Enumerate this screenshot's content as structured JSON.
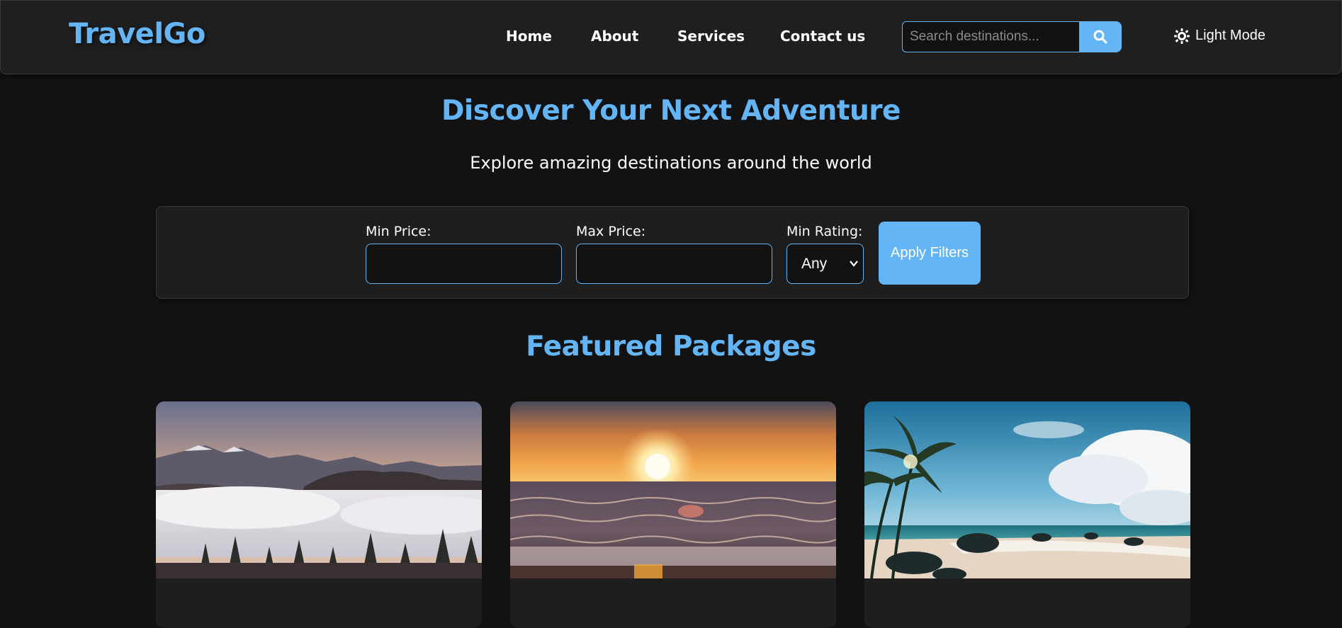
{
  "brand": {
    "name": "TravelGo"
  },
  "nav": {
    "links": [
      "Home",
      "About",
      "Services",
      "Contact us"
    ]
  },
  "search": {
    "placeholder": "Search destinations...",
    "icon": "search-icon"
  },
  "theme_toggle": {
    "label": "Light Mode",
    "icon": "sun-icon"
  },
  "hero": {
    "title": "Discover Your Next Adventure",
    "subtitle": "Explore amazing destinations around the world"
  },
  "filters": {
    "min_price_label": "Min Price:",
    "min_price_value": "",
    "max_price_label": "Max Price:",
    "max_price_value": "",
    "min_rating_label": "Min Rating:",
    "min_rating_value": "Any",
    "apply_label": "Apply Filters"
  },
  "featured": {
    "title": "Featured Packages",
    "cards": [
      {
        "image": "misty mountains at sunrise",
        "title": ""
      },
      {
        "image": "ocean sunset waves",
        "title": ""
      },
      {
        "image": "tropical beach with palms",
        "title": ""
      }
    ]
  },
  "colors": {
    "accent": "#64b5f6",
    "background": "#121212",
    "surface": "#1f1f1f"
  }
}
